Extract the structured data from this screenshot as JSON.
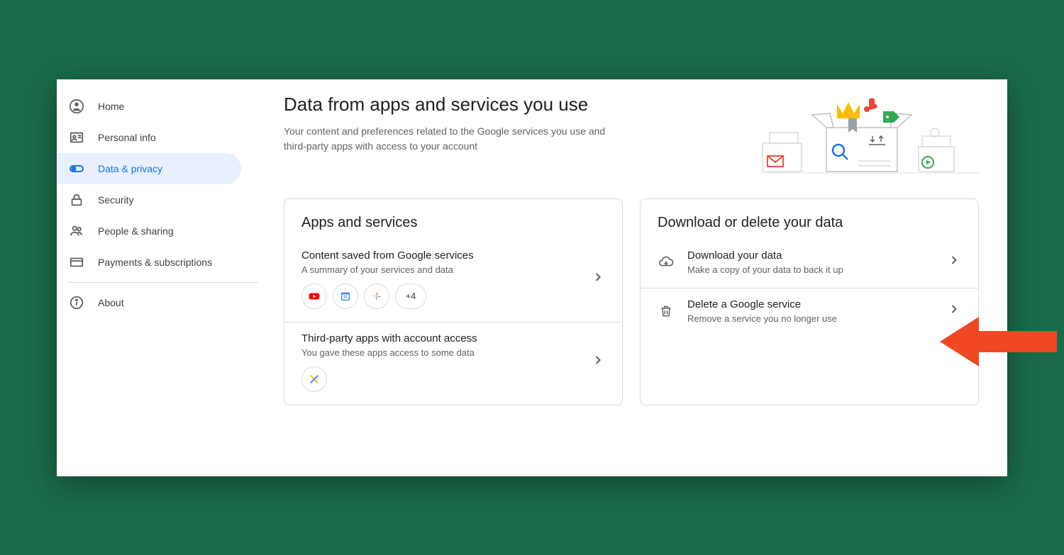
{
  "sidebar": {
    "items": [
      {
        "label": "Home",
        "icon": "account-circle"
      },
      {
        "label": "Personal info",
        "icon": "badge"
      },
      {
        "label": "Data & privacy",
        "icon": "toggle"
      },
      {
        "label": "Security",
        "icon": "lock"
      },
      {
        "label": "People & sharing",
        "icon": "people"
      },
      {
        "label": "Payments & subscriptions",
        "icon": "card"
      },
      {
        "label": "About",
        "icon": "info"
      }
    ],
    "active_index": 2
  },
  "header": {
    "title": "Data from apps and services you use",
    "subtitle": "Your content and preferences related to the Google services you use and third-party apps with access to your account"
  },
  "card_apps": {
    "title": "Apps and services",
    "rows": [
      {
        "title": "Content saved from Google services",
        "subtitle": "A summary of your services and data",
        "chips": [
          "youtube",
          "calendar",
          "photos"
        ],
        "more_chip": "+4"
      },
      {
        "title": "Third-party apps with account access",
        "subtitle": "You gave these apps access to some data",
        "chips": [
          "cross"
        ],
        "more_chip": null
      }
    ]
  },
  "card_download": {
    "title": "Download or delete your data",
    "rows": [
      {
        "icon": "cloud-download",
        "title": "Download your data",
        "subtitle": "Make a copy of your data to back it up"
      },
      {
        "icon": "trash",
        "title": "Delete a Google service",
        "subtitle": "Remove a service you no longer use"
      }
    ]
  },
  "annotation": {
    "arrow_color": "#ef4823",
    "target": "delete-google-service-row"
  }
}
